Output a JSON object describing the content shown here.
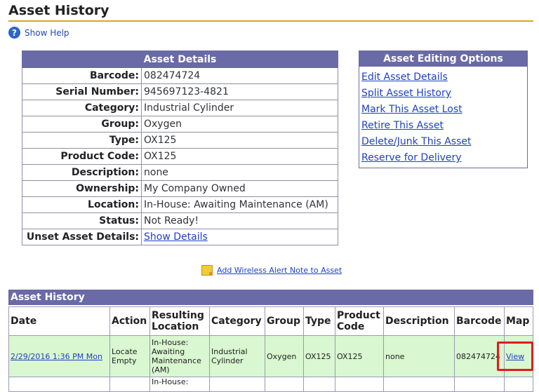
{
  "page": {
    "title": "Asset History",
    "help_label": "Show Help"
  },
  "details": {
    "heading": "Asset Details",
    "rows": [
      {
        "label": "Barcode:",
        "value": "082474724"
      },
      {
        "label": "Serial Number:",
        "value": "945697123-4821"
      },
      {
        "label": "Category:",
        "value": "Industrial Cylinder"
      },
      {
        "label": "Group:",
        "value": "Oxygen"
      },
      {
        "label": "Type:",
        "value": "OX125"
      },
      {
        "label": "Product Code:",
        "value": "OX125"
      },
      {
        "label": "Description:",
        "value": "none"
      },
      {
        "label": "Ownership:",
        "value": "My Company Owned"
      },
      {
        "label": "Location:",
        "value": "In-House: Awaiting Maintenance (AM)"
      },
      {
        "label": "Status:",
        "value": "Not Ready!"
      },
      {
        "label": "Unset Asset Details:",
        "value": "Show Details"
      }
    ]
  },
  "options": {
    "heading": "Asset Editing Options",
    "links": [
      "Edit Asset Details",
      "Split Asset History",
      "Mark This Asset Lost",
      "Retire This Asset",
      "Delete/Junk This Asset",
      "Reserve for Delivery"
    ]
  },
  "alert": {
    "label": "Add Wireless Alert Note to Asset"
  },
  "history": {
    "heading": "Asset History",
    "columns": [
      "Date",
      "Action",
      "Resulting Location",
      "Category",
      "Group",
      "Type",
      "Product Code",
      "Description",
      "Barcode",
      "Map"
    ],
    "rows": [
      {
        "date": "2/29/2016 1:36 PM Mon",
        "action": "Locate Empty",
        "location": "In-House: Awaiting Maintenance (AM)",
        "category": "Industrial Cylinder",
        "group": "Oxygen",
        "type": "OX125",
        "product_code": "OX125",
        "description": "none",
        "barcode": "082474724",
        "map": "View"
      },
      {
        "date": "",
        "action": "",
        "location": "In-House:",
        "category": "",
        "group": "",
        "type": "",
        "product_code": "",
        "description": "",
        "barcode": "",
        "map": ""
      }
    ]
  },
  "colors": {
    "header_bg": "#6a6aa6",
    "row_highlight": "#d9f7d0",
    "title_underline": "#d9a526",
    "callout": "#e11b1b"
  }
}
